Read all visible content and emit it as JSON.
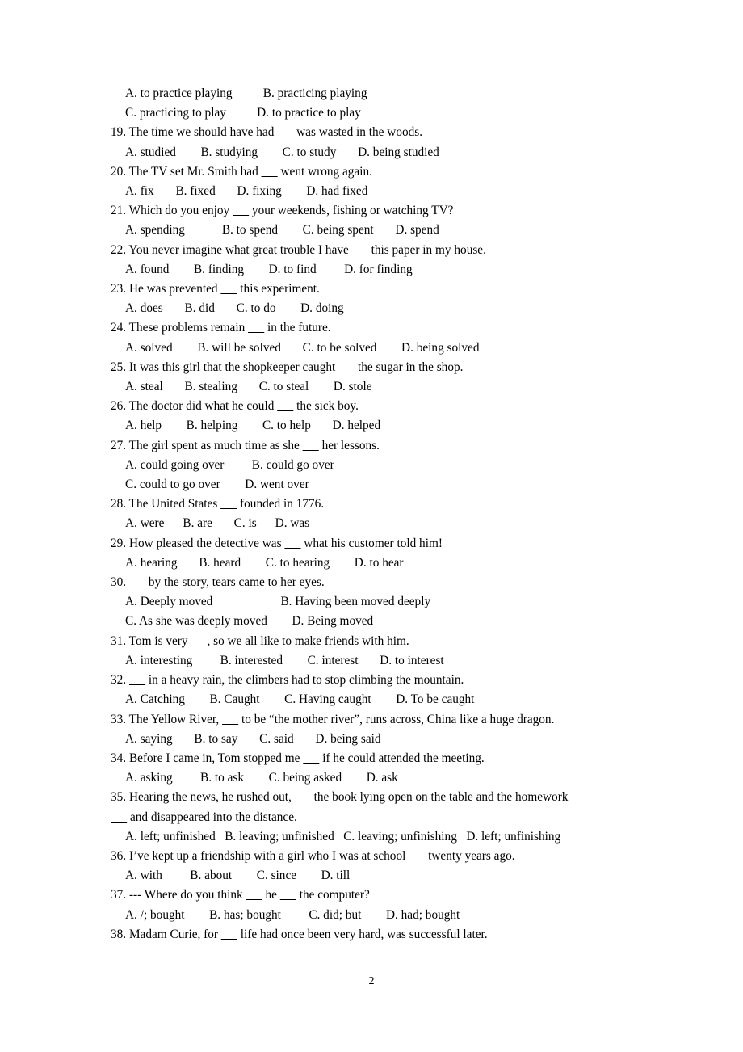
{
  "document": {
    "page_number": "2",
    "blank": "_____",
    "lines": [
      {
        "kind": "option",
        "text": "A. to practice playing          B. practicing playing"
      },
      {
        "kind": "option",
        "text": "C. practicing to play          D. to practice to play"
      },
      {
        "kind": "question",
        "text": "19. The time we should have had _____ was wasted in the woods."
      },
      {
        "kind": "option",
        "text": "A. studied        B. studying        C. to study       D. being studied"
      },
      {
        "kind": "question",
        "text": "20. The TV set Mr. Smith had _____ went wrong again."
      },
      {
        "kind": "option",
        "text": "A. fix       B. fixed       D. fixing        D. had fixed"
      },
      {
        "kind": "question",
        "text": "21. Which do you enjoy _____ your weekends, fishing or watching TV?"
      },
      {
        "kind": "option",
        "text": "A. spending            B. to spend        C. being spent       D. spend"
      },
      {
        "kind": "question",
        "text": "22. You never imagine what great trouble I have _____ this paper in my house."
      },
      {
        "kind": "option",
        "text": "A. found        B. finding        D. to find         D. for finding"
      },
      {
        "kind": "question",
        "text": "23. He was prevented _____ this experiment."
      },
      {
        "kind": "option",
        "text": "A. does       B. did       C. to do        D. doing"
      },
      {
        "kind": "question",
        "text": "24. These problems remain _____ in the future."
      },
      {
        "kind": "option",
        "text": "A. solved        B. will be solved       C. to be solved        D. being solved"
      },
      {
        "kind": "question",
        "text": "25. It was this girl that the shopkeeper caught _____ the sugar in the shop."
      },
      {
        "kind": "option",
        "text": "A. steal       B. stealing       C. to steal        D. stole"
      },
      {
        "kind": "question",
        "text": "26. The doctor did what he could _____ the sick boy."
      },
      {
        "kind": "option",
        "text": "A. help        B. helping        C. to help       D. helped"
      },
      {
        "kind": "question",
        "text": "27. The girl spent as much time as she _____ her lessons."
      },
      {
        "kind": "option",
        "text": "A. could going over         B. could go over"
      },
      {
        "kind": "option",
        "text": "C. could to go over        D. went over"
      },
      {
        "kind": "question",
        "text": "28. The United States _____ founded in 1776."
      },
      {
        "kind": "option",
        "text": "A. were      B. are       C. is      D. was"
      },
      {
        "kind": "question",
        "text": "29. How pleased the detective was _____ what his customer told him!"
      },
      {
        "kind": "option",
        "text": "A. hearing       B. heard        C. to hearing        D. to hear"
      },
      {
        "kind": "question",
        "text": "30. _____ by the story, tears came to her eyes."
      },
      {
        "kind": "option",
        "text": "A. Deeply moved                      B. Having been moved deeply"
      },
      {
        "kind": "option",
        "text": "C. As she was deeply moved        D. Being moved"
      },
      {
        "kind": "question",
        "text": "31. Tom is very _____, so we all like to make friends with him."
      },
      {
        "kind": "option",
        "text": "A. interesting         B. interested        C. interest       D. to interest"
      },
      {
        "kind": "question",
        "text": "32. _____ in a heavy rain, the climbers had to stop climbing the mountain."
      },
      {
        "kind": "option",
        "text": "A. Catching        B. Caught        C. Having caught        D. To be caught"
      },
      {
        "kind": "question",
        "text": "33. The Yellow River, _____ to be “the mother river”, runs across, China like a huge dragon."
      },
      {
        "kind": "option",
        "text": "A. saying       B. to say       C. said       D. being said"
      },
      {
        "kind": "question",
        "text": "34. Before I came in, Tom stopped me _____ if he could attended the meeting."
      },
      {
        "kind": "option",
        "text": "A. asking         B. to ask        C. being asked        D. ask"
      },
      {
        "kind": "question",
        "text": "35. Hearing the news, he rushed out, _____ the book lying open on the table and the homework"
      },
      {
        "kind": "continuation",
        "text": "_____ and disappeared into the distance."
      },
      {
        "kind": "option",
        "text": "A. left; unfinished   B. leaving; unfinished   C. leaving; unfinishing   D. left; unfinishing"
      },
      {
        "kind": "question",
        "text": "36. I’ve kept up a friendship with a girl who I was at school _____ twenty years ago."
      },
      {
        "kind": "option",
        "text": "A. with         B. about        C. since        D. till"
      },
      {
        "kind": "question",
        "text": "37. --- Where do you think _____ he _____ the computer?"
      },
      {
        "kind": "option",
        "text": "A. /; bought        B. has; bought         C. did; but        D. had; bought"
      },
      {
        "kind": "question",
        "text": "38. Madam Curie, for _____ life had once been very hard, was successful later."
      }
    ]
  }
}
